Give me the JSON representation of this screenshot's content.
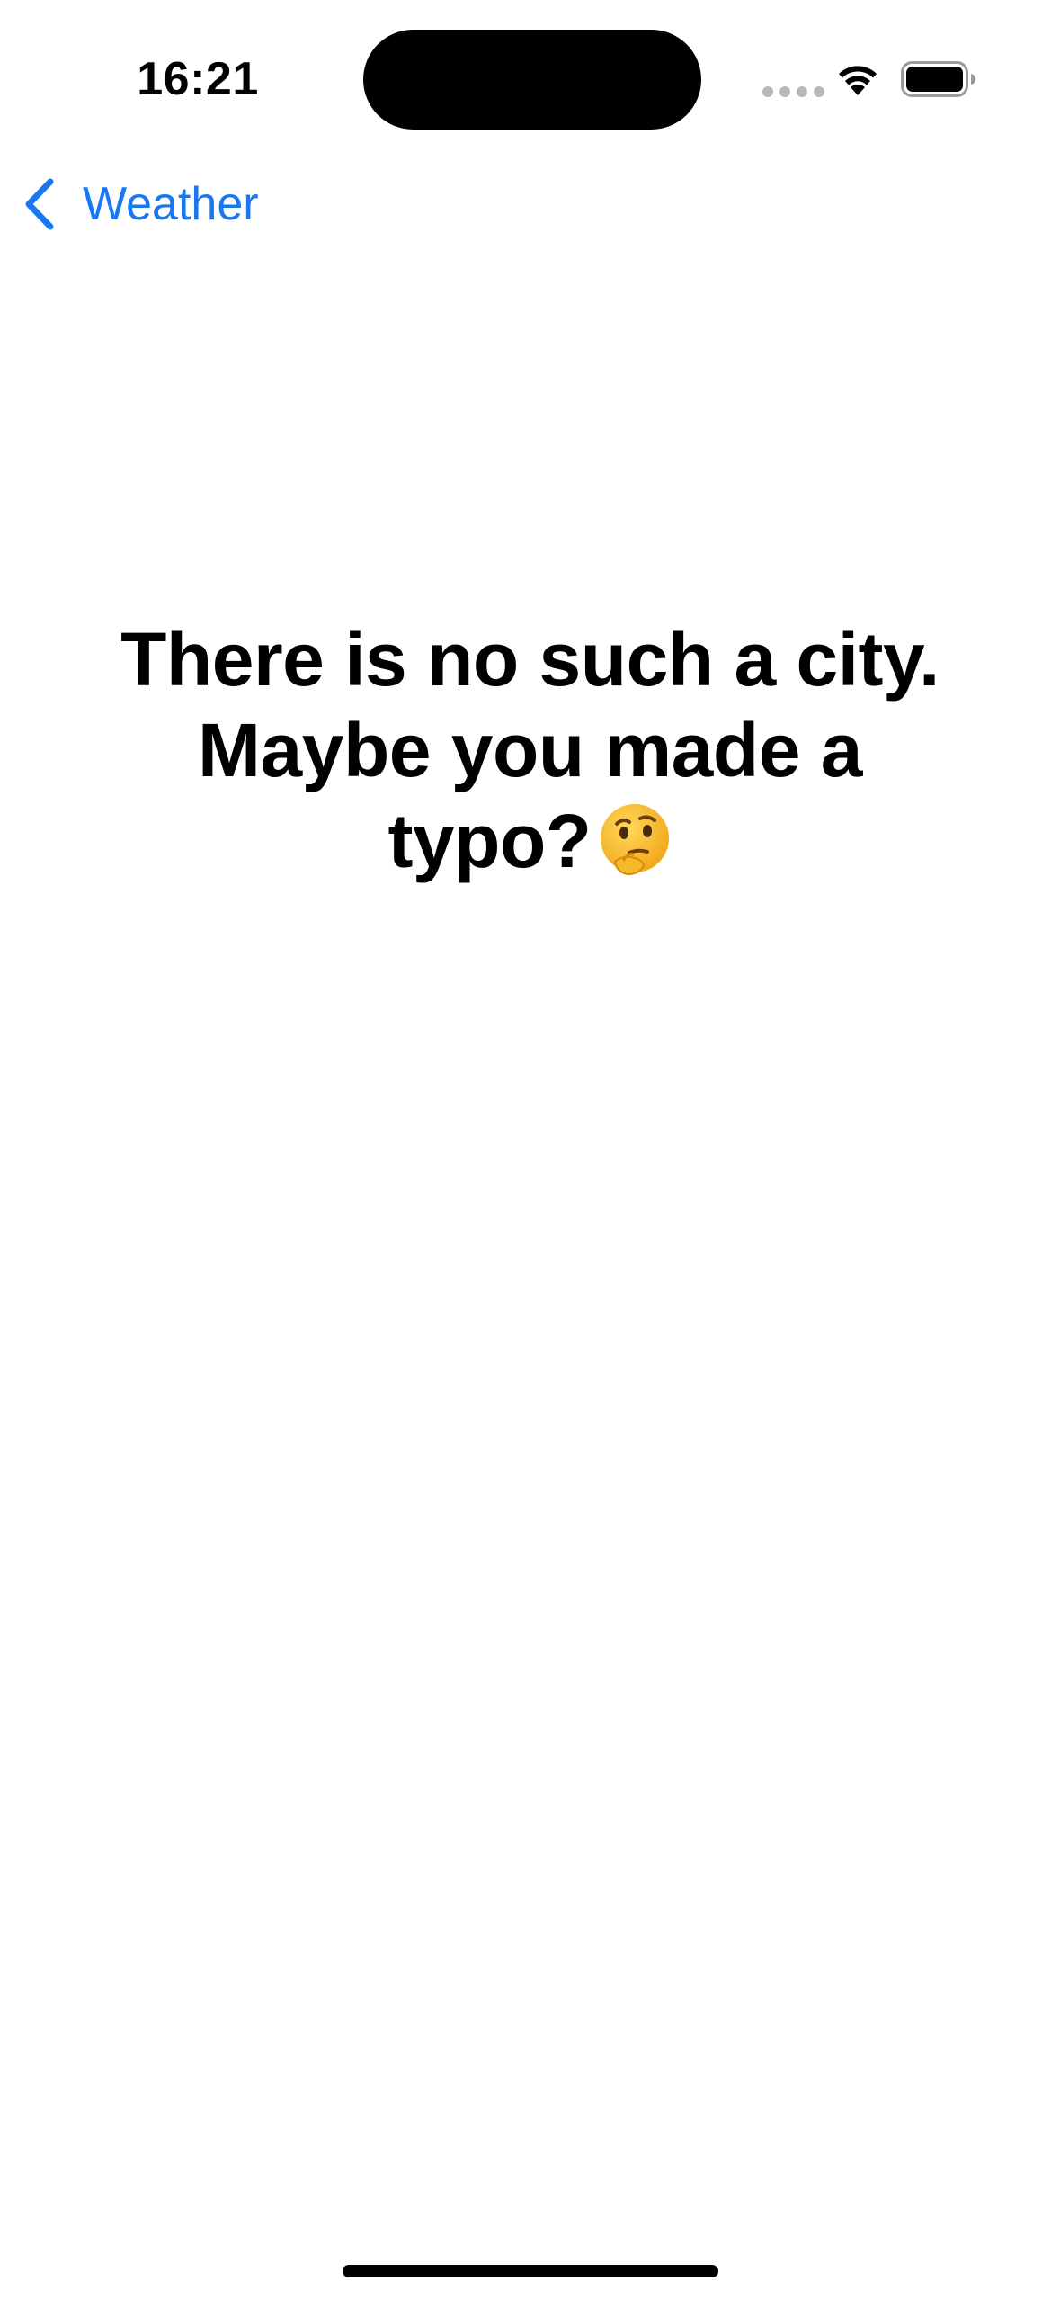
{
  "status_bar": {
    "time": "16:21",
    "icons": [
      "cellular-signal-icon",
      "wifi-icon",
      "battery-icon"
    ]
  },
  "nav": {
    "back_label": "Weather",
    "back_icon": "chevron-left-icon"
  },
  "message": {
    "text": "There is no such a city. Maybe you made a typo?",
    "emoji": "thinking-face-icon"
  },
  "colors": {
    "accent": "#1877f2",
    "text": "#000000",
    "background": "#ffffff",
    "emoji_yellow": "#f7b928"
  }
}
